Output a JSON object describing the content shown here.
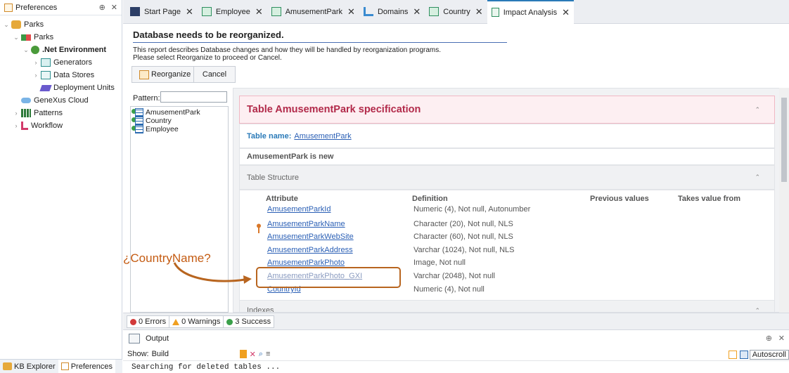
{
  "left_panel": {
    "title": "Preferences",
    "pin_glyph": "⊕",
    "close_glyph": "✕",
    "tree": [
      {
        "label": "Parks",
        "indent": 0,
        "expanded": true,
        "icon": "parks-db-icon",
        "bold": false
      },
      {
        "label": "Parks",
        "indent": 1,
        "expanded": true,
        "icon": "environment-root-icon",
        "bold": false
      },
      {
        "label": ".Net Environment",
        "indent": 2,
        "expanded": true,
        "icon": "net-environment-icon",
        "bold": true
      },
      {
        "label": "Generators",
        "indent": 3,
        "expanded": false,
        "icon": "generators-icon",
        "bold": false
      },
      {
        "label": "Data Stores",
        "indent": 3,
        "expanded": false,
        "icon": "data-stores-icon",
        "bold": false
      },
      {
        "label": "Deployment Units",
        "indent": 3,
        "expanded": null,
        "icon": "deployment-units-icon",
        "bold": false
      },
      {
        "label": "GeneXus Cloud",
        "indent": 1,
        "expanded": null,
        "icon": "genexus-cloud-icon",
        "bold": false
      },
      {
        "label": "Patterns",
        "indent": 1,
        "expanded": false,
        "icon": "patterns-icon",
        "bold": false
      },
      {
        "label": "Workflow",
        "indent": 1,
        "expanded": false,
        "icon": "workflow-icon",
        "bold": false
      }
    ],
    "footer_tabs": [
      "KB Explorer",
      "Preferences"
    ]
  },
  "tabs": [
    {
      "label": "Start Page",
      "icon": "start-page-icon",
      "active": false
    },
    {
      "label": "Employee",
      "icon": "transaction-icon",
      "active": false
    },
    {
      "label": "AmusementPark",
      "icon": "transaction-icon",
      "active": false
    },
    {
      "label": "Domains",
      "icon": "domains-icon",
      "active": false
    },
    {
      "label": "Country",
      "icon": "transaction-icon",
      "active": false
    },
    {
      "label": "Impact Analysis",
      "icon": "impact-analysis-icon",
      "active": true
    }
  ],
  "tab_close": "✕",
  "impact": {
    "title": "Database needs to be reorganized.",
    "description_line1": "This report describes Database changes and how they will be handled by reorganization programs.",
    "description_line2": "Please select Reorganize to proceed or Cancel.",
    "reorganize_label": "Reorganize",
    "cancel_label": "Cancel",
    "pattern_label": "Pattern:",
    "pattern_value": "",
    "objects": [
      "AmusementPark",
      "Country",
      "Employee"
    ]
  },
  "report": {
    "spec_title": "Table AmusementPark specification",
    "table_name_label": "Table name:",
    "table_name": "AmusementPark",
    "new_text": "AmusementPark is new",
    "structure_label": "Table Structure",
    "columns": [
      "Attribute",
      "Definition",
      "Previous values",
      "Takes value from"
    ],
    "attributes": [
      {
        "name": "AmusementParkId",
        "definition": "Numeric (4), Not null, Autonumber",
        "key": true
      },
      {
        "name": "AmusementParkName",
        "definition": "Character (20), Not null, NLS",
        "key": false
      },
      {
        "name": "AmusementParkWebSite",
        "definition": "Character (60), Not null, NLS",
        "key": false
      },
      {
        "name": "AmusementParkAddress",
        "definition": "Varchar (1024), Not null, NLS",
        "key": false
      },
      {
        "name": "AmusementParkPhoto",
        "definition": "Image, Not null",
        "key": false
      },
      {
        "name": "AmusementParkPhoto_GXI",
        "definition": "Varchar (2048), Not null",
        "key": false
      },
      {
        "name": "CountryId",
        "definition": "Numeric (4), Not null",
        "key": false
      }
    ],
    "indexes_label": "Indexes",
    "collapse_glyph": "⌃"
  },
  "annotation": {
    "text": "¿CountryName?",
    "color": "#c45b12"
  },
  "status": {
    "errors": "0 Errors",
    "warnings": "0 Warnings",
    "success": "3 Success"
  },
  "output": {
    "title": "Output",
    "show_label": "Show:",
    "show_value": "Build",
    "log_line": "Searching for deleted tables ...",
    "autoscroll_label": "Autoscroll"
  }
}
